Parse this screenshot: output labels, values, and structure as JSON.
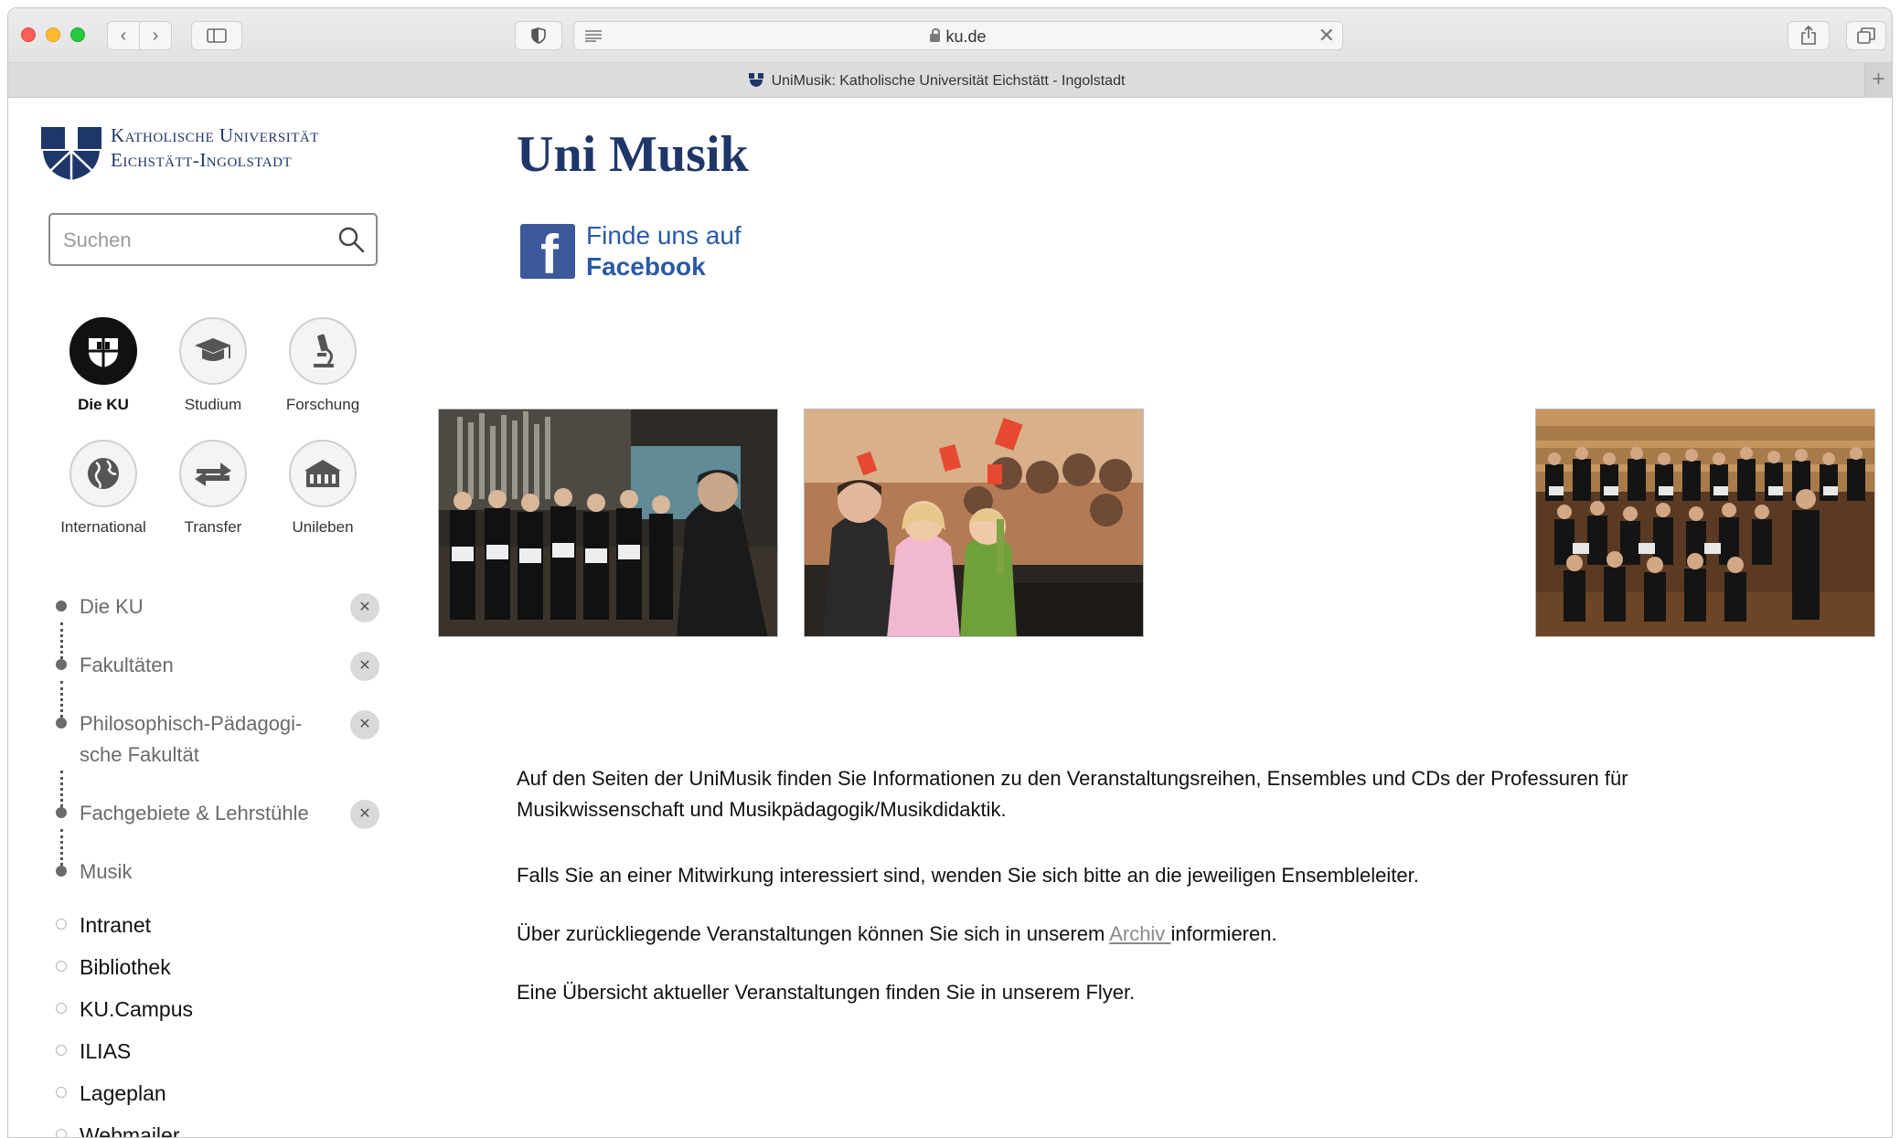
{
  "browser": {
    "url": "ku.de",
    "tab_title": "UniMusik: Katholische Universität Eichstätt - Ingolstadt",
    "new_tab": "+"
  },
  "sidebar": {
    "logo_line1": "Katholische Universität",
    "logo_line2": "Eichstätt-Ingolstadt",
    "search_placeholder": "Suchen",
    "nav": [
      {
        "label": "Die KU",
        "icon": "ku-shield-icon",
        "active": true
      },
      {
        "label": "Studium",
        "icon": "graduation-cap-icon",
        "active": false
      },
      {
        "label": "Forschung",
        "icon": "microscope-icon",
        "active": false
      },
      {
        "label": "International",
        "icon": "globe-icon",
        "active": false
      },
      {
        "label": "Transfer",
        "icon": "arrows-exchange-icon",
        "active": false
      },
      {
        "label": "Unileben",
        "icon": "building-icon",
        "active": false
      }
    ],
    "breadcrumbs": [
      {
        "label": "Die KU",
        "closable": true
      },
      {
        "label": "Fakultäten",
        "closable": true
      },
      {
        "label": "Philosophisch-Pädagogi-\nsche Fakultät",
        "closable": true
      },
      {
        "label": "Fachgebiete & Lehrstühle",
        "closable": true
      },
      {
        "label": "Musik",
        "closable": false
      }
    ],
    "links": [
      "Intranet",
      "Bibliothek",
      "KU.Campus",
      "ILIAS",
      "Lageplan",
      "Webmailer"
    ]
  },
  "main": {
    "title": "Uni Musik",
    "facebook_line1": "Finde uns auf",
    "facebook_line2": "Facebook",
    "photos": [
      "choir-photo",
      "children-audience-photo",
      "orchestra-photo"
    ],
    "para1": "Auf den Seiten der UniMusik finden Sie Informationen zu den Veranstaltungsreihen, Ensembles und CDs der Professuren für Musikwissenschaft und Musikpädagogik/Musikdidaktik.",
    "para2": "Falls Sie an einer Mitwirkung interessiert sind, wenden Sie sich bitte an die jeweiligen Ensembleleiter.",
    "para3_before": "Über zurückliegende Veranstaltungen können Sie sich in unserem ",
    "para3_link": "Archiv ",
    "para3_after": "informieren.",
    "para4": "Eine Übersicht aktueller Veranstaltungen finden Sie in unserem Flyer."
  },
  "colors": {
    "brand": "#1f3669",
    "facebook": "#3b5998"
  }
}
